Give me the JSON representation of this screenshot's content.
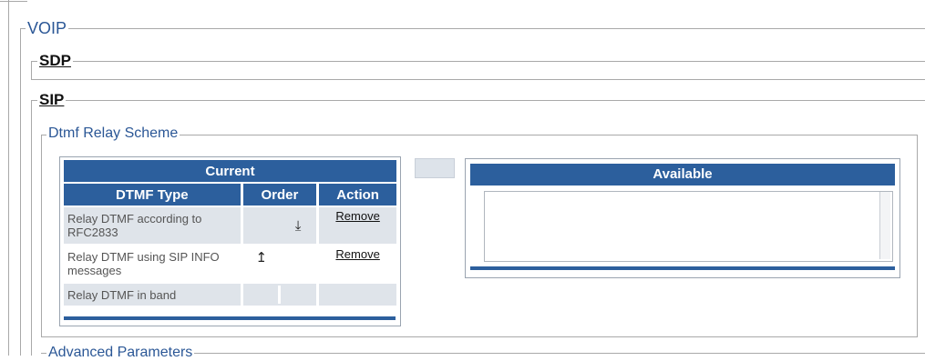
{
  "sections": {
    "voip_label": "VOIP",
    "sdp_label": "SDP",
    "sip_label": "SIP",
    "dtmf_relay_label": "Dtmf Relay Scheme",
    "advanced_label": "Advanced Parameters"
  },
  "current_table": {
    "title": "Current",
    "headers": [
      "DTMF Type",
      "Order",
      "Action"
    ],
    "rows": [
      {
        "type": "Relay DTMF according to RFC2833",
        "order_icon": "arrow-down",
        "action": "Remove"
      },
      {
        "type": "Relay DTMF using SIP INFO messages",
        "order_icon": "arrow-up",
        "action": "Remove"
      },
      {
        "type": "Relay DTMF in band",
        "order_icon": "",
        "action": ""
      }
    ]
  },
  "available_table": {
    "title": "Available"
  },
  "colors": {
    "header_blue": "#2c5f9d",
    "legend_blue": "#2b5796",
    "row_shade": "#dfe4ea"
  },
  "icons": {
    "arrow_down": "⤓",
    "arrow_up": "↥"
  }
}
